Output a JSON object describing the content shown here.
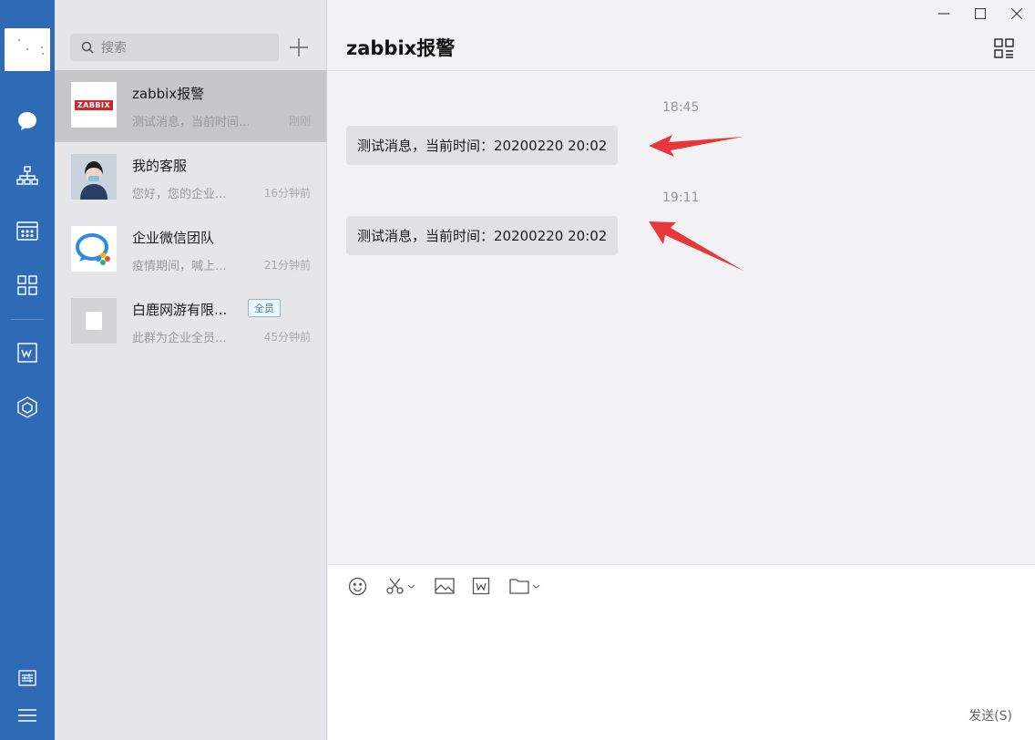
{
  "search": {
    "placeholder": "搜索"
  },
  "conversations": [
    {
      "name": "zabbix报警",
      "preview": "测试消息，当前时间...",
      "time": "刚刚",
      "avatar_text": "ZABBIX"
    },
    {
      "name": "我的客服",
      "preview": "您好，您的企业...",
      "time": "16分钟前"
    },
    {
      "name": "企业微信团队",
      "preview": "疫情期间，喊上...",
      "time": "21分钟前"
    },
    {
      "name": "白鹿网游有限...",
      "preview": "此群为企业全员...",
      "time": "45分钟前",
      "tag": "全员"
    }
  ],
  "chat": {
    "title": "zabbix报警",
    "messages": [
      {
        "timestamp": "18:45",
        "text": "测试消息，当前时间：20200220 20:02"
      },
      {
        "timestamp": "19:11",
        "text": "测试消息，当前时间：20200220 20:02"
      }
    ],
    "send_label": "发送(S)"
  },
  "colors": {
    "rail": "#2f6ab7",
    "annotation_arrow": "#e8373a",
    "zabbix_red": "#d3232b"
  },
  "icons": {
    "rail": [
      "chat-icon",
      "org-chart-icon",
      "calendar-icon",
      "apps-grid-icon",
      "doc-w-icon",
      "cube-icon",
      "settings-icon",
      "menu-icon"
    ],
    "toolbar": [
      "emoji-icon",
      "screenshot-scissors-icon",
      "image-icon",
      "word-doc-icon",
      "folder-icon"
    ]
  }
}
